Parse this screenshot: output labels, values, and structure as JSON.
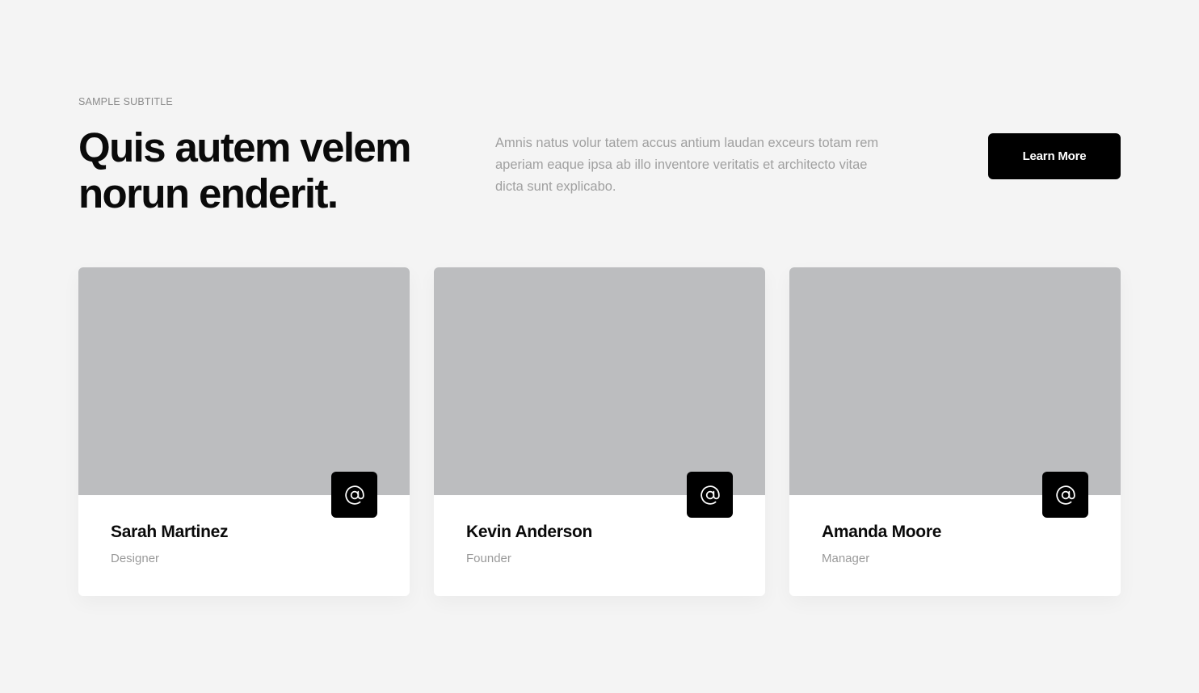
{
  "header": {
    "subtitle": "SAMPLE SUBTITLE",
    "headline": "Quis autem velem norun enderit.",
    "description": "Amnis natus volur tatem accus antium laudan exceurs totam rem aperiam eaque ipsa ab illo inventore veritatis et architecto vitae dicta sunt explicabo.",
    "cta_label": "Learn More"
  },
  "team": [
    {
      "name": "Sarah Martinez",
      "role": "Designer",
      "icon": "at-sign-icon"
    },
    {
      "name": "Kevin Anderson",
      "role": "Founder",
      "icon": "at-sign-icon"
    },
    {
      "name": "Amanda Moore",
      "role": "Manager",
      "icon": "at-sign-icon"
    }
  ],
  "colors": {
    "background": "#f4f4f4",
    "text_primary": "#0a0a0a",
    "text_muted": "#9a9a9a",
    "button_bg": "#000000",
    "button_text": "#ffffff",
    "image_placeholder": "#bcbdbf",
    "card_bg": "#ffffff"
  }
}
